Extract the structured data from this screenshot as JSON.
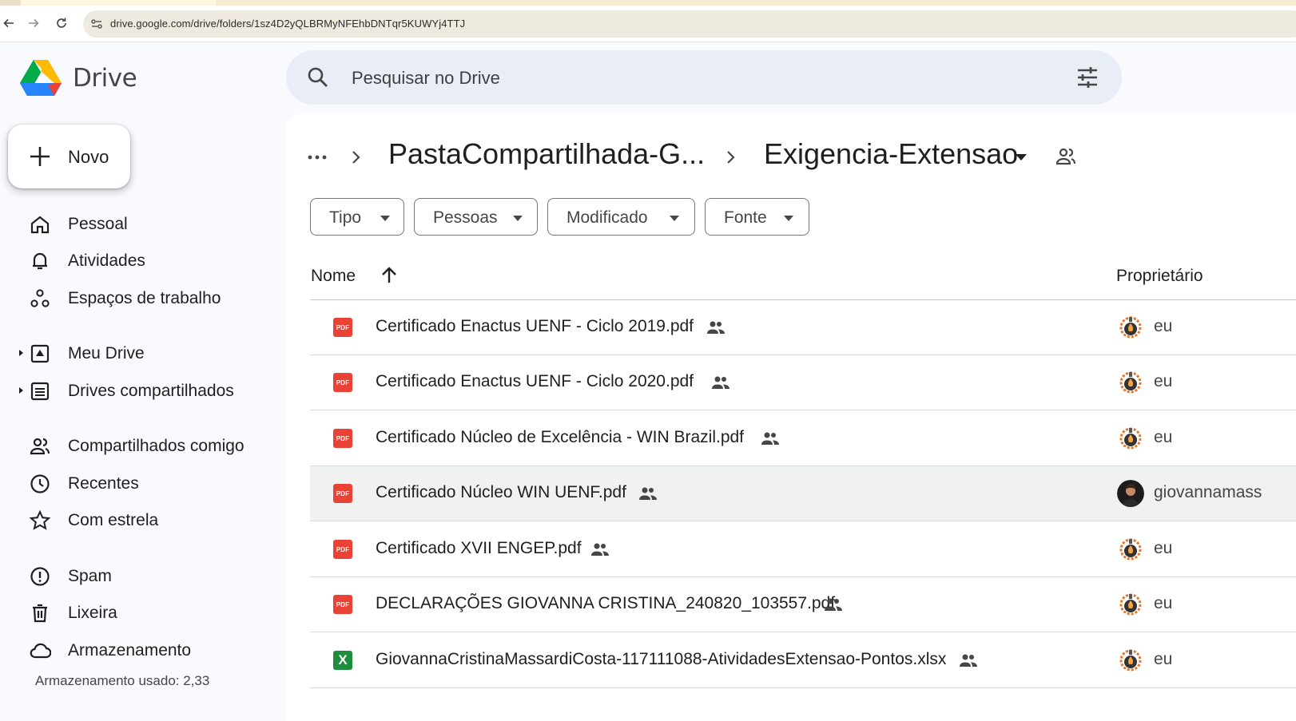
{
  "browser": {
    "url": "drive.google.com/drive/folders/1sz4D2yQLBRMyNFEhbDNTqr5KUWYj4TTJ"
  },
  "app": {
    "brand": "Drive",
    "search_placeholder": "Pesquisar no Drive"
  },
  "sidebar": {
    "new_label": "Novo",
    "items": [
      {
        "label": "Pessoal",
        "icon": "home-icon"
      },
      {
        "label": "Atividades",
        "icon": "bell-icon"
      },
      {
        "label": "Espaços de trabalho",
        "icon": "workspaces-icon"
      },
      {
        "label": "Meu Drive",
        "icon": "my-drive-icon"
      },
      {
        "label": "Drives compartilhados",
        "icon": "shared-drives-icon"
      },
      {
        "label": "Compartilhados comigo",
        "icon": "people-icon"
      },
      {
        "label": "Recentes",
        "icon": "clock-icon"
      },
      {
        "label": "Com estrela",
        "icon": "star-icon"
      },
      {
        "label": "Spam",
        "icon": "spam-icon"
      },
      {
        "label": "Lixeira",
        "icon": "trash-icon"
      },
      {
        "label": "Armazenamento",
        "icon": "cloud-icon"
      }
    ],
    "storage_text": "Armazenamento usado: 2,33"
  },
  "breadcrumb": {
    "parent": "PastaCompartilhada-G...",
    "current": "Exigencia-Extensao"
  },
  "filters": [
    "Tipo",
    "Pessoas",
    "Modificado",
    "Fonte"
  ],
  "table": {
    "col_name": "Nome",
    "col_owner": "Proprietário",
    "rows": [
      {
        "name": "Certificado Enactus UENF - Ciclo 2019.pdf",
        "type": "pdf",
        "type_label": "PDF",
        "owner": "eu"
      },
      {
        "name": "Certificado Enactus UENF - Ciclo 2020.pdf",
        "type": "pdf",
        "type_label": "PDF",
        "owner": "eu"
      },
      {
        "name": "Certificado Núcleo de Excelência - WIN Brazil.pdf",
        "type": "pdf",
        "type_label": "PDF",
        "owner": "eu"
      },
      {
        "name": "Certificado Núcleo WIN UENF.pdf",
        "type": "pdf",
        "type_label": "PDF",
        "owner": "giovannamass"
      },
      {
        "name": "Certificado XVII ENGEP.pdf",
        "type": "pdf",
        "type_label": "PDF",
        "owner": "eu"
      },
      {
        "name": "DECLARAÇÕES GIOVANNA CRISTINA_240820_103557.pdf",
        "type": "pdf",
        "type_label": "PDF",
        "owner": "eu"
      },
      {
        "name": "GiovannaCristinaMassardiCosta-117111088-AtividadesExtensao-Pontos.xlsx",
        "type": "xls",
        "type_label": "X",
        "owner": "eu"
      }
    ]
  }
}
